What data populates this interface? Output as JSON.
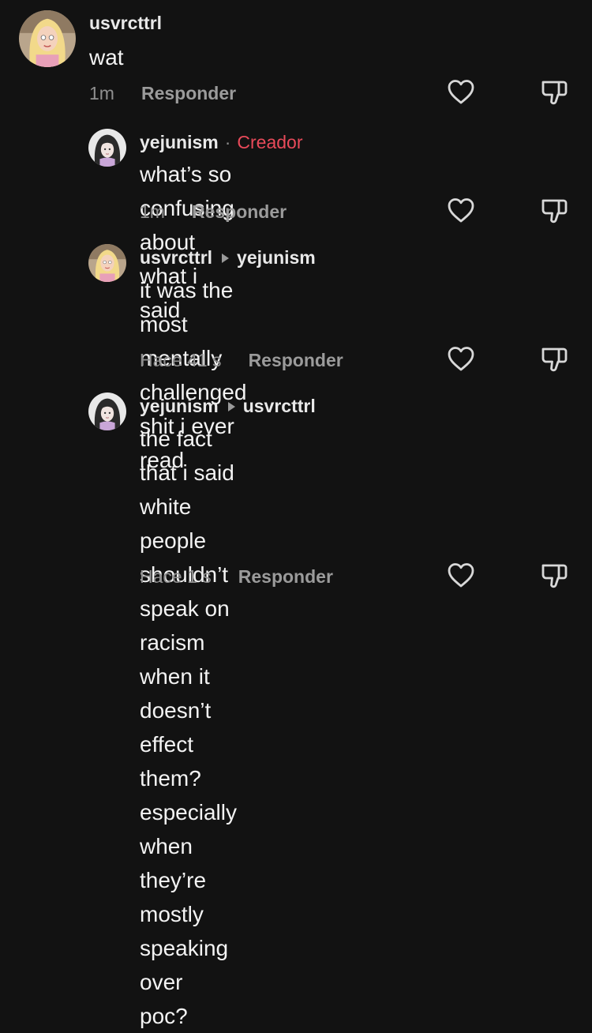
{
  "comments": [
    {
      "username": "usvrcttrl",
      "text": "wat",
      "time": "1m",
      "reply_label": "Responder"
    },
    {
      "username": "yejunism",
      "separator": "·",
      "creator_tag": "Creador",
      "text": "what’s so confusing about what i said",
      "time": "1m",
      "reply_label": "Responder"
    },
    {
      "username": "usvrcttrl",
      "reply_to": "yejunism",
      "text_lines": [
        "it was the most mentally challenged",
        "shit i ever read"
      ],
      "time": "Hace 41 s",
      "reply_label": "Responder"
    },
    {
      "username": "yejunism",
      "reply_to": "usvrcttrl",
      "text_lines": [
        "the fact that i said white people",
        "shouldn’t speak on racism when it",
        "doesn’t effect them? especially when",
        "they’re mostly speaking over poc?"
      ],
      "time": "Hace 1 s",
      "reply_label": "Responder"
    }
  ],
  "icons": {
    "like": "heart-outline-icon",
    "dislike": "thumbs-down-outline-icon",
    "reply_arrow": "triangle-right-icon"
  },
  "colors": {
    "background": "#121212",
    "creator_accent": "#e94a5a",
    "meta_gray": "#8f8f8f"
  }
}
